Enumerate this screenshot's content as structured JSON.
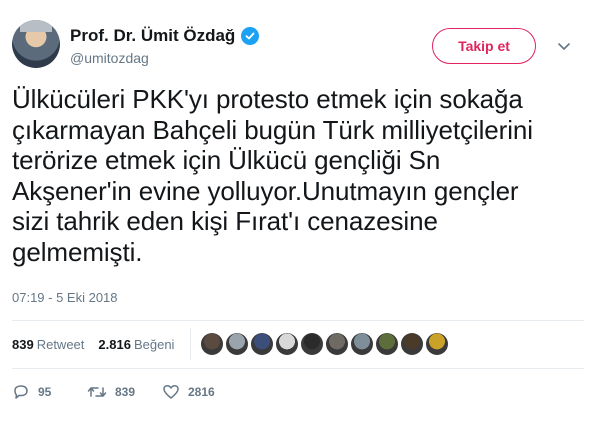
{
  "header": {
    "display_name": "Prof. Dr. Ümit Özdağ",
    "handle": "@umitozdag",
    "follow_label": "Takip et"
  },
  "tweet": {
    "lines": [
      "Ülkücüleri PKK'yı protesto etmek için sokağa",
      "çıkarmayan Bahçeli bugün Türk milliyetçilerini",
      "terörize etmek için Ülkücü gençliği Sn",
      "Akşener'in evine yolluyor.Unutmayın gençler",
      "sizi tahrik eden kişi Fırat'ı cenazesine",
      "gelmemişti."
    ],
    "timestamp": "07:19 - 5 Eki 2018"
  },
  "stats": {
    "retweets": "839",
    "retweets_label": "Retweet",
    "likes": "2.816",
    "likes_label": "Beğeni",
    "liker_colors": [
      "#5a4a3f",
      "#9aa4ad",
      "#3b4f7a",
      "#d8d8d8",
      "#2b2b2b",
      "#6f6a64",
      "#7e8f99",
      "#5e6e3b",
      "#4a3a2a",
      "#c9a227"
    ]
  },
  "actions": {
    "reply_count": "95",
    "retweet_count": "839",
    "like_count": "2816"
  },
  "colors": {
    "brand_blue": "#1da1f2",
    "follow_red": "#e0245e",
    "secondary_text": "#657786",
    "divider": "#e6ecf0"
  },
  "icons": {
    "verified": "verified-badge-icon",
    "caret": "chevron-down-icon",
    "reply": "reply-icon",
    "retweet": "retweet-icon",
    "like": "heart-icon"
  }
}
